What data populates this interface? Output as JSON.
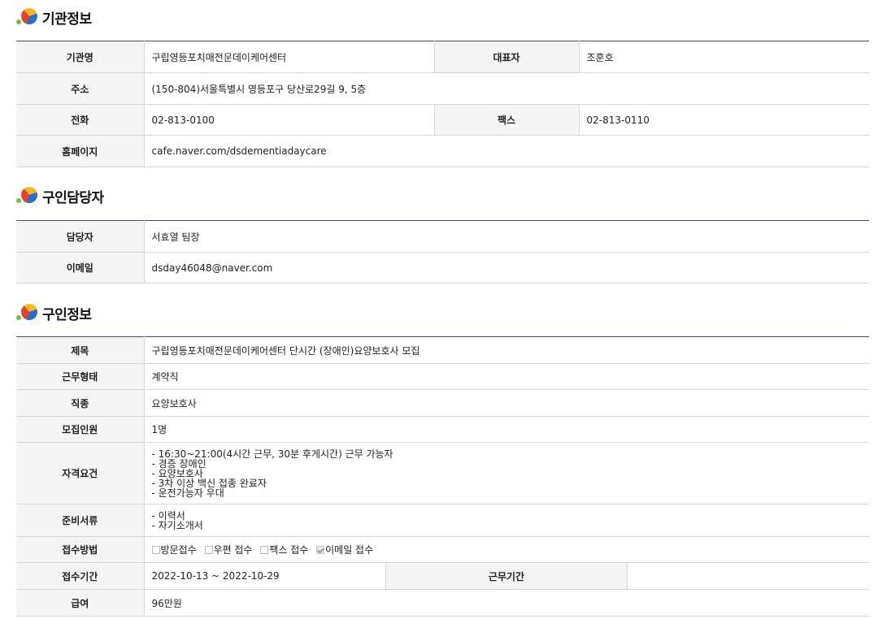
{
  "org": {
    "title": "기관정보",
    "name_label": "기관명",
    "name": "구립영등포치매전문데이케어센터",
    "rep_label": "대표자",
    "rep": "조훈호",
    "addr_label": "주소",
    "addr": "(150-804)서울특별시 영등포구 당산로29길 9, 5층",
    "tel_label": "전화",
    "tel": "02-813-0100",
    "fax_label": "팩스",
    "fax": "02-813-0110",
    "home_label": "홈페이지",
    "home": "cafe.naver.com/dsdementiadaycare"
  },
  "contact": {
    "title": "구인담당자",
    "person_label": "담당자",
    "person": "서효열 팀장",
    "email_label": "이메일",
    "email": "dsday46048@naver.com"
  },
  "job": {
    "title": "구인정보",
    "subject_label": "제목",
    "subject": "구립영등포치매전문데이케어센터 단시간 (장애인)요양보호사 모집",
    "type_label": "근무형태",
    "type": "계약직",
    "role_label": "직종",
    "role": "요양보호사",
    "count_label": "모집인원",
    "count": "1명",
    "qual_label": "자격요건",
    "qual": [
      "- 16:30~21:00(4시간 근무, 30분 후게시간) 근무 가능자",
      "- 경증 장애인",
      "- 요양보호사",
      "- 3차 이상 백신 접종 완료자",
      "- 운전가능자 우대"
    ],
    "docs_label": "준비서류",
    "docs": [
      "- 이력서",
      "- 자기소개서"
    ],
    "method_label": "접수방법",
    "methods": [
      {
        "label": "방문접수",
        "checked": false
      },
      {
        "label": "우편 접수",
        "checked": false
      },
      {
        "label": "팩스 접수",
        "checked": false
      },
      {
        "label": "이메일 접수",
        "checked": true
      }
    ],
    "period_label": "접수기간",
    "period": "2022-10-13 ~ 2022-10-29",
    "workperiod_label": "근무기간",
    "workperiod": "",
    "pay_label": "급여",
    "pay": "96만원"
  }
}
